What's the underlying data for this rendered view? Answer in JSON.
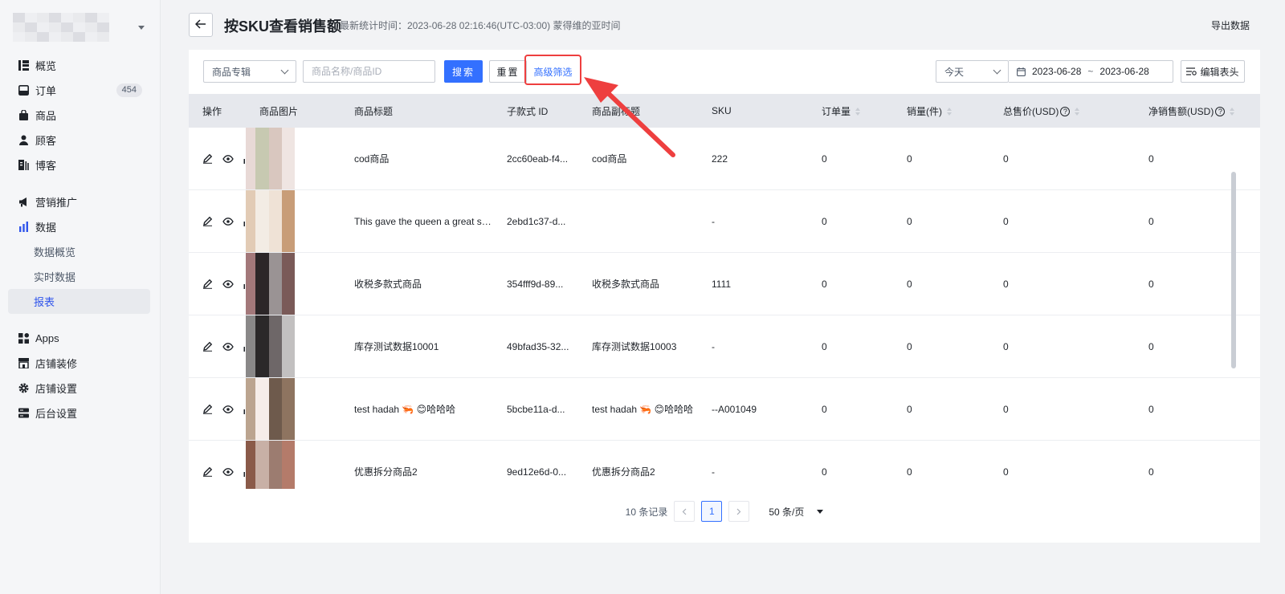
{
  "sidebar": {
    "items": [
      {
        "label": "概览",
        "icon": "overview-icon"
      },
      {
        "label": "订单",
        "icon": "order-icon",
        "badge": "454"
      },
      {
        "label": "商品",
        "icon": "product-icon"
      },
      {
        "label": "顾客",
        "icon": "customer-icon"
      },
      {
        "label": "博客",
        "icon": "blog-icon"
      },
      {
        "label": "营销推广",
        "icon": "megaphone-icon"
      },
      {
        "label": "数据",
        "icon": "chart-icon"
      },
      {
        "label": "数据概览"
      },
      {
        "label": "实时数据"
      },
      {
        "label": "报表"
      },
      {
        "label": "Apps",
        "icon": "apps-icon"
      },
      {
        "label": "店铺装修",
        "icon": "store-icon"
      },
      {
        "label": "店铺设置",
        "icon": "gear-icon"
      },
      {
        "label": "后台设置",
        "icon": "server-icon"
      }
    ],
    "active_color": "#2f54eb"
  },
  "header": {
    "title": "按SKU查看销售额",
    "stat_time": "最新统计时间：2023-06-28 02:16:46(UTC-03:00) 蒙得维的亚时间",
    "export_label": "导出数据"
  },
  "toolbar": {
    "collection_select": "商品专辑",
    "search_placeholder": "商品名称/商品ID",
    "search_label": "搜索",
    "reset_label": "重置",
    "advanced_label": "高级筛选",
    "period_select": "今天",
    "date_start": "2023-06-28",
    "date_sep": "~",
    "date_end": "2023-06-28",
    "edit_columns_label": "编辑表头"
  },
  "table": {
    "columns": [
      "操作",
      "商品图片",
      "商品标题",
      "子款式 ID",
      "商品副标题",
      "SKU",
      "订单量",
      "销量(件)",
      "总售价(USD)",
      "净销售额(USD)"
    ],
    "rows": [
      {
        "title": "cod商品",
        "variant_id": "2cc60eab-f4...",
        "subtitle": "cod商品",
        "sku": "222",
        "orders": "0",
        "sales": "0",
        "total": "0",
        "net": "0"
      },
      {
        "title": "This gave the queen a great sh...",
        "variant_id": "2ebd1c37-d...",
        "subtitle": "",
        "sku": "-",
        "orders": "0",
        "sales": "0",
        "total": "0",
        "net": "0"
      },
      {
        "title": "收税多款式商品",
        "variant_id": "354fff9d-89...",
        "subtitle": "收税多款式商品",
        "sku": "1111",
        "orders": "0",
        "sales": "0",
        "total": "0",
        "net": "0"
      },
      {
        "title": "库存测试数据10001",
        "variant_id": "49bfad35-32...",
        "subtitle": "库存测试数据10003",
        "sku": "-",
        "orders": "0",
        "sales": "0",
        "total": "0",
        "net": "0"
      },
      {
        "title": "test hadah 🦐 😊哈哈哈",
        "variant_id": "5bcbe11a-d...",
        "subtitle": "test hadah 🦐 😊哈哈哈",
        "sku": "--A001049",
        "orders": "0",
        "sales": "0",
        "total": "0",
        "net": "0"
      },
      {
        "title": "优惠拆分商品2",
        "variant_id": "9ed12e6d-0...",
        "subtitle": "优惠拆分商品2",
        "sku": "-",
        "orders": "0",
        "sales": "0",
        "total": "0",
        "net": "0"
      }
    ]
  },
  "pagination": {
    "total_text": "10 条记录",
    "current_page": "1",
    "page_size": "50 条/页"
  },
  "colors": {
    "primary": "#3370ff",
    "highlight": "#ee3f3f"
  }
}
